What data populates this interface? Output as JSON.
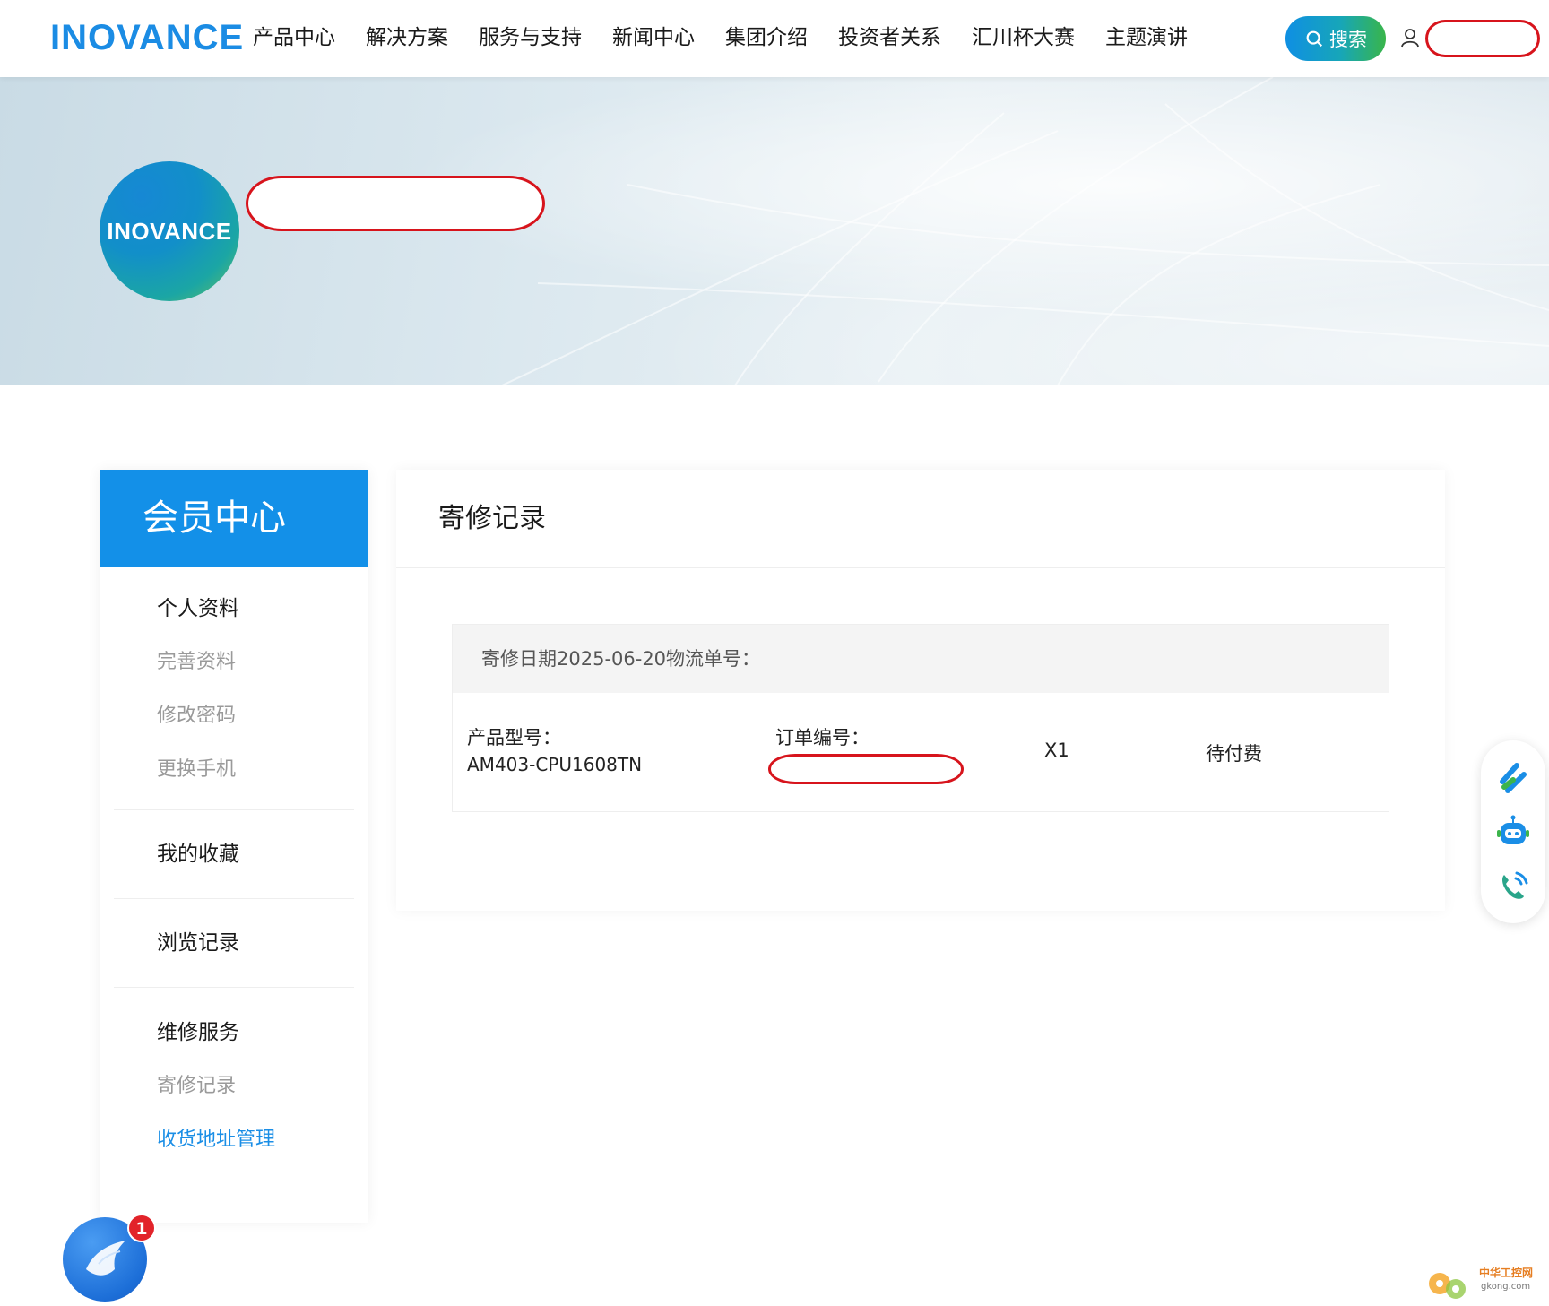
{
  "header": {
    "logo_text": "INOVANCE",
    "nav": [
      {
        "label": "产品中心"
      },
      {
        "label": "解决方案"
      },
      {
        "label": "服务与支持"
      },
      {
        "label": "新闻中心"
      },
      {
        "label": "集团介绍"
      },
      {
        "label": "投资者关系"
      },
      {
        "label": "汇川杯大赛"
      },
      {
        "label": "主题演讲"
      }
    ],
    "search_label": "搜索",
    "user_icon": "user-icon"
  },
  "banner": {
    "avatar_text": "INOVANCE"
  },
  "sidebar": {
    "title": "会员中心",
    "groups": [
      {
        "title": "个人资料",
        "items": [
          "完善资料",
          "修改密码",
          "更换手机"
        ]
      },
      {
        "title": "我的收藏",
        "items": []
      },
      {
        "title": "浏览记录",
        "items": []
      },
      {
        "title": "维修服务",
        "items": [
          "寄修记录",
          "收货地址管理"
        ]
      }
    ],
    "active_item": "收货地址管理"
  },
  "main": {
    "title": "寄修记录",
    "records": [
      {
        "header_text": "寄修日期2025-06-20物流单号：",
        "product_label": "产品型号：",
        "product_value": "AM403-CPU1608TN",
        "order_label": "订单编号：",
        "quantity": "X1",
        "status": "待付费"
      }
    ]
  },
  "widgets": {
    "chat_badge_count": "1",
    "float_icons": [
      "quick-link-icon",
      "robot-assistant-icon",
      "phone-icon"
    ],
    "watermark_text": "中华工控网",
    "watermark_domain": "gkong.com"
  },
  "colors": {
    "brand_blue": "#1b8ce4",
    "sidebar_head": "#1390e8",
    "active_link": "#1a8ee6",
    "redaction": "#d7141c"
  }
}
